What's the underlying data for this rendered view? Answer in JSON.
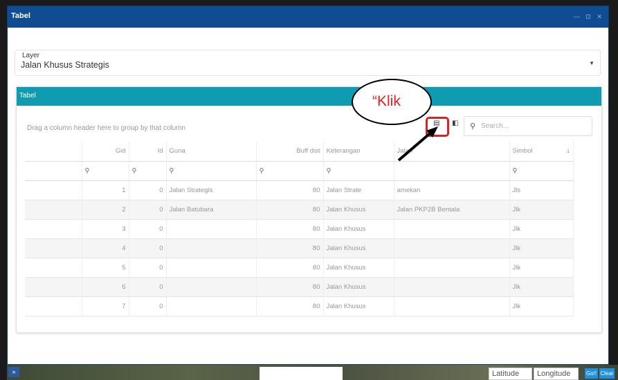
{
  "window": {
    "title": "Tabel",
    "controls": "— ⊡ ✕"
  },
  "layer": {
    "label": "Layer",
    "value": "Jalan Khusus Strategis"
  },
  "panel": {
    "title": "Tabel",
    "group_hint": "Drag a column header here to group by that column",
    "search_placeholder": "Search..."
  },
  "columns": [
    "Gid",
    "Id",
    "Guna",
    "Buff dist",
    "Keterangan",
    "Jalan",
    "Simbol"
  ],
  "rows": [
    {
      "gid": "1",
      "id": "0",
      "guna": "Jalan Strategis",
      "buff": "80",
      "ket": "Jalan Strate",
      "jalan": "amekan",
      "simbol": "Jls"
    },
    {
      "gid": "2",
      "id": "0",
      "guna": "Jalan Batubara",
      "buff": "80",
      "ket": "Jalan Khusus",
      "jalan": "Jalan PKP2B Bentala",
      "simbol": "Jlk"
    },
    {
      "gid": "3",
      "id": "0",
      "guna": "",
      "buff": "80",
      "ket": "Jalan Khusus",
      "jalan": "",
      "simbol": "Jlk"
    },
    {
      "gid": "4",
      "id": "0",
      "guna": "",
      "buff": "80",
      "ket": "Jalan Khusus",
      "jalan": "",
      "simbol": "Jlk"
    },
    {
      "gid": "5",
      "id": "0",
      "guna": "",
      "buff": "80",
      "ket": "Jalan Khusus",
      "jalan": "",
      "simbol": "Jlk"
    },
    {
      "gid": "6",
      "id": "0",
      "guna": "",
      "buff": "80",
      "ket": "Jalan Khusus",
      "jalan": "",
      "simbol": "Jlk"
    },
    {
      "gid": "7",
      "id": "0",
      "guna": "",
      "buff": "80",
      "ket": "Jalan Khusus",
      "jalan": "",
      "simbol": "Jlk"
    }
  ],
  "annotation": {
    "text": "“Klik"
  },
  "bottom": {
    "latitude": "Latitude",
    "longitude": "Longitude",
    "go": "Go!!",
    "clear": "Clear",
    "expand": "»"
  },
  "colors": {
    "titlebar": "#0f4c91",
    "panel_header": "#0f9cb0",
    "highlight": "#e0201f"
  }
}
